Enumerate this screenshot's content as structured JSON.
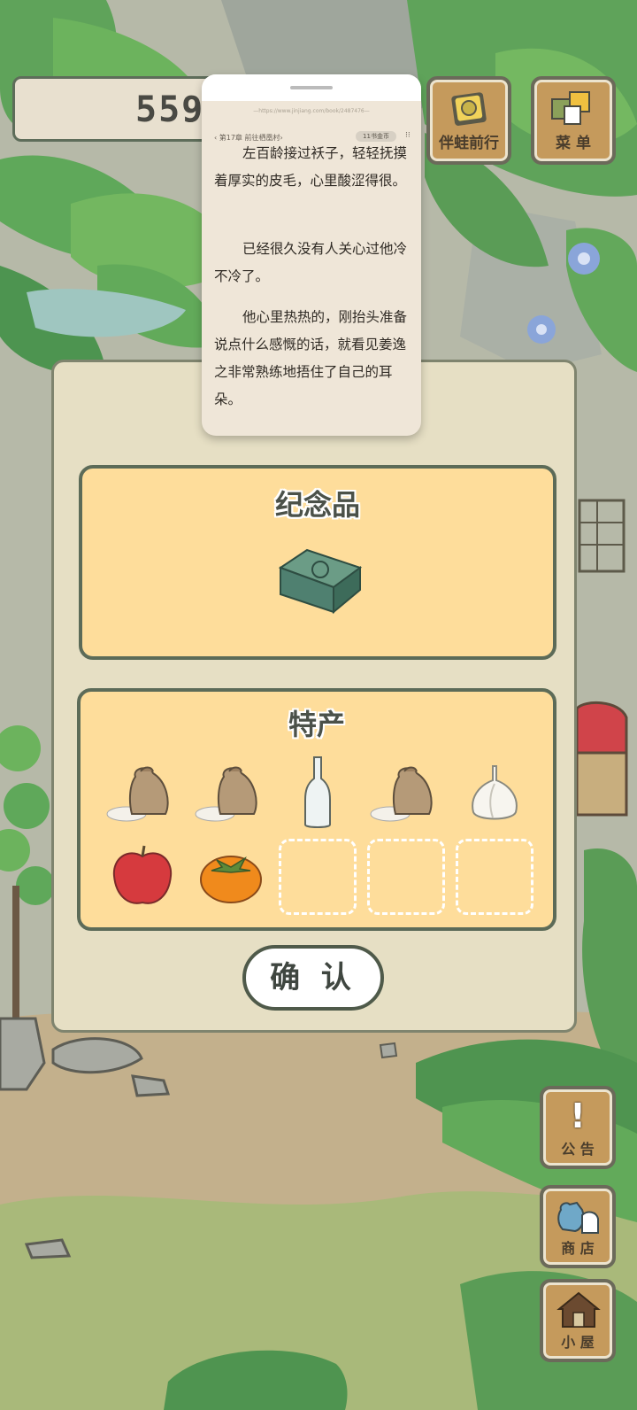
{
  "counter": {
    "value": "559"
  },
  "top_buttons": {
    "travel_label": "伴蛙前行",
    "menu_label": "菜 单"
  },
  "reader": {
    "url": "—https://www.jinjiang.com/book/2487476—",
    "chapter": "‹ 第17章 前往栖凰村›",
    "coin_badge": "11书金币",
    "paragraphs": [
      "左百龄接过袄子，轻轻抚摸着厚实的皮毛，心里酸涩得很。",
      "已经很久没有人关心过他冷不冷了。",
      "他心里热热的，刚抬头准备说点什么感慨的话，就看见姜逸之非常熟练地捂住了自己的耳朵。"
    ]
  },
  "souvenir": {
    "title": "纪念品",
    "item_icon": "jade-plaque-icon"
  },
  "specialty": {
    "title": "特产",
    "items": [
      "rice-sack-icon",
      "rice-sack-icon",
      "glass-bottle-icon",
      "rice-sack-icon",
      "garlic-icon",
      "apple-icon",
      "persimmon-icon",
      "empty",
      "empty",
      "empty"
    ]
  },
  "confirm": {
    "label": "确 认"
  },
  "side_buttons": {
    "notice_label": "公 告",
    "shop_label": "商 店",
    "house_label": "小 屋"
  },
  "colors": {
    "panel_bg": "#e6dfc4",
    "box_bg": "#fedd9b",
    "border": "#5c6b58",
    "wood": "#c59a5c"
  }
}
